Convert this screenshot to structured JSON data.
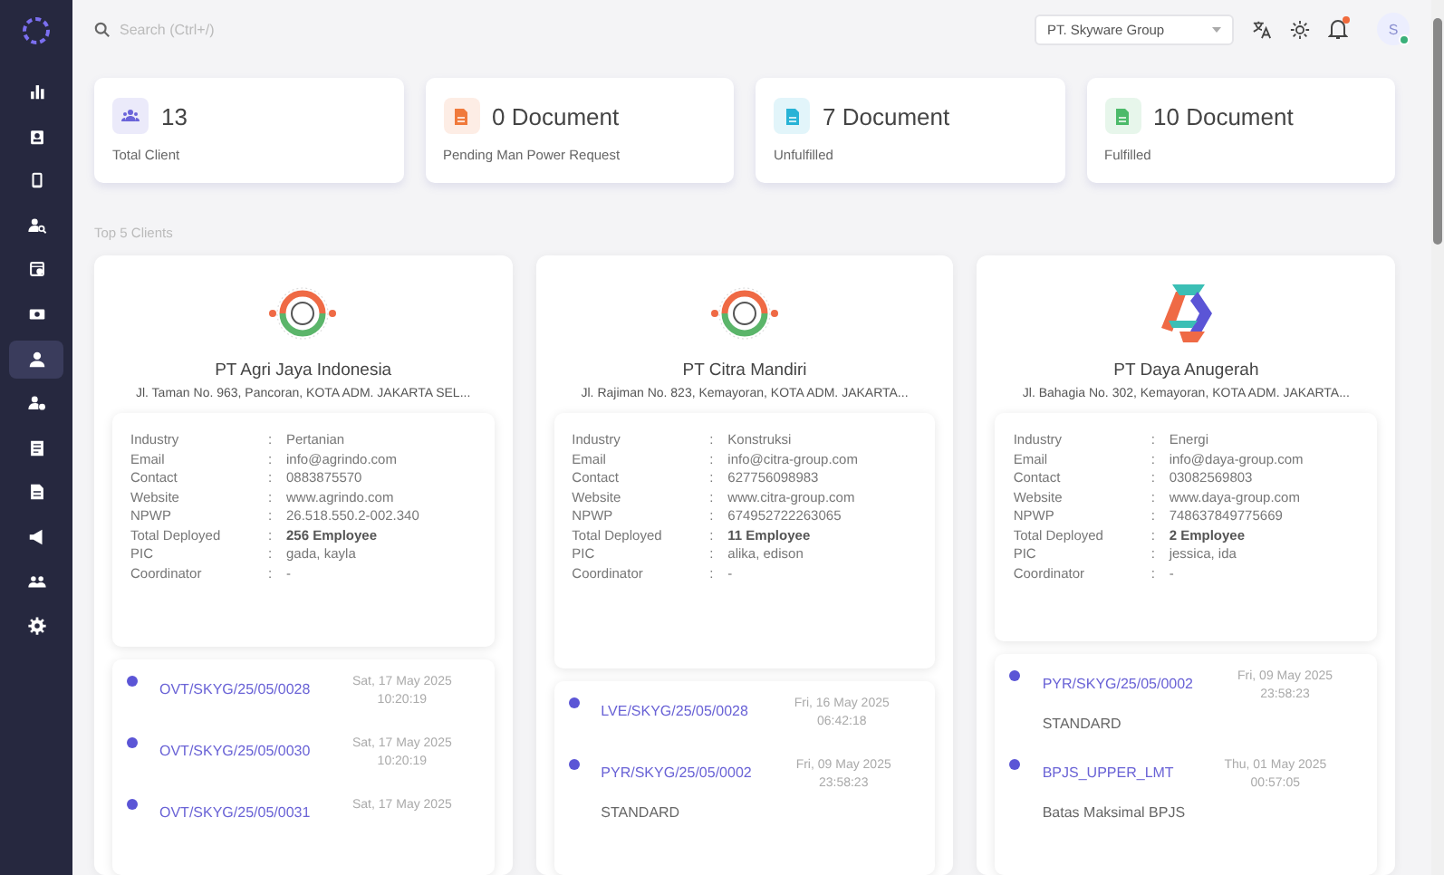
{
  "sidebar": {
    "items": [
      {
        "selected": false
      },
      {
        "selected": false
      },
      {
        "selected": false
      },
      {
        "selected": false
      },
      {
        "selected": false
      },
      {
        "selected": false
      },
      {
        "selected": true
      },
      {
        "selected": false
      },
      {
        "selected": false
      },
      {
        "selected": false
      },
      {
        "selected": false
      },
      {
        "selected": false
      },
      {
        "selected": false
      }
    ]
  },
  "header": {
    "search": {
      "placeholder": "Search (Ctrl+/)"
    },
    "company_select": {
      "value": "PT. Skyware Group"
    },
    "notifications": {
      "unread": true
    },
    "avatar": {
      "initial": "S",
      "online": true
    }
  },
  "stats": [
    {
      "value": "13",
      "label": "Total Client",
      "color": "#6a63d9"
    },
    {
      "value": "0 Document",
      "label": "Pending Man Power Request",
      "color": "#f07a3c"
    },
    {
      "value": "7 Document",
      "label": "Unfulfilled",
      "color": "#27b3d6"
    },
    {
      "value": "10 Document",
      "label": "Fulfilled",
      "color": "#4cba6a"
    }
  ],
  "section_title": "Top 5 Clients",
  "clients": [
    {
      "name": "PT Agri Jaya Indonesia",
      "address": "Jl. Taman No. 963, Pancoran, KOTA ADM. JAKARTA SEL...",
      "details": [
        {
          "label": "Industry",
          "separator": ":",
          "value": "Pertanian",
          "bold": false
        },
        {
          "label": "Email",
          "separator": ":",
          "value": "info@agrindo.com",
          "bold": false
        },
        {
          "label": "Contact",
          "separator": ":",
          "value": "0883875570",
          "bold": false
        },
        {
          "label": "Website",
          "separator": ":",
          "value": "www.agrindo.com",
          "bold": false
        },
        {
          "label": "NPWP",
          "separator": ":",
          "value": "26.518.550.2-002.340",
          "bold": false
        },
        {
          "label": "Total Deployed",
          "separator": ":",
          "value": "256 Employee",
          "bold": true
        },
        {
          "label": "PIC",
          "separator": ":",
          "value": "gada, kayla",
          "bold": false
        },
        {
          "label": "Coordinator",
          "separator": ":",
          "value": "-",
          "bold": false
        }
      ],
      "timeline": [
        {
          "code": "OVT/SKYG/25/05/0028",
          "date": "Sat, 17 May 2025 10:20:19"
        },
        {
          "code": "OVT/SKYG/25/05/0030",
          "date": "Sat, 17 May 2025 10:20:19"
        },
        {
          "code": "OVT/SKYG/25/05/0031",
          "date": "Sat, 17 May 2025"
        }
      ]
    },
    {
      "name": "PT Citra Mandiri",
      "address": "Jl. Rajiman No. 823, Kemayoran, KOTA ADM. JAKARTA...",
      "details": [
        {
          "label": "Industry",
          "separator": ":",
          "value": "Konstruksi",
          "bold": false
        },
        {
          "label": "Email",
          "separator": ":",
          "value": "info@citra-group.com",
          "bold": false
        },
        {
          "label": "Contact",
          "separator": ":",
          "value": "627756098983",
          "bold": false
        },
        {
          "label": "Website",
          "separator": ":",
          "value": "www.citra-group.com",
          "bold": false
        },
        {
          "label": "NPWP",
          "separator": ":",
          "value": "674952722263065",
          "bold": false
        },
        {
          "label": "Total Deployed",
          "separator": ":",
          "value": "11 Employee",
          "bold": true
        },
        {
          "label": "PIC",
          "separator": ":",
          "value": "alika, edison",
          "bold": false
        },
        {
          "label": "Coordinator",
          "separator": ":",
          "value": "-",
          "bold": false
        }
      ],
      "timeline": [
        {
          "code": "LVE/SKYG/25/05/0028",
          "date": "Fri, 16 May 2025 06:42:18"
        },
        {
          "code": "PYR/SKYG/25/05/0002",
          "date": "Fri, 09 May 2025 23:58:23",
          "description": "STANDARD"
        }
      ]
    },
    {
      "name": "PT Daya Anugerah",
      "address": "Jl. Bahagia No. 302, Kemayoran, KOTA ADM. JAKARTA...",
      "details": [
        {
          "label": "Industry",
          "separator": ":",
          "value": "Energi",
          "bold": false
        },
        {
          "label": "Email",
          "separator": ":",
          "value": "info@daya-group.com",
          "bold": false
        },
        {
          "label": "Contact",
          "separator": ":",
          "value": "03082569803",
          "bold": false
        },
        {
          "label": "Website",
          "separator": ":",
          "value": "www.daya-group.com",
          "bold": false
        },
        {
          "label": "NPWP",
          "separator": ":",
          "value": "748637849775669",
          "bold": false
        },
        {
          "label": "Total Deployed",
          "separator": ":",
          "value": "2 Employee",
          "bold": true
        },
        {
          "label": "PIC",
          "separator": ":",
          "value": "jessica, ida",
          "bold": false
        },
        {
          "label": "Coordinator",
          "separator": ":",
          "value": "-",
          "bold": false
        }
      ],
      "timeline": [
        {
          "code": "PYR/SKYG/25/05/0002",
          "date": "Fri, 09 May 2025 23:58:23",
          "description": "STANDARD"
        },
        {
          "code": "BPJS_UPPER_LMT",
          "date": "Thu, 01 May 2025 00:57:05",
          "description": "Batas Maksimal BPJS"
        }
      ]
    }
  ]
}
